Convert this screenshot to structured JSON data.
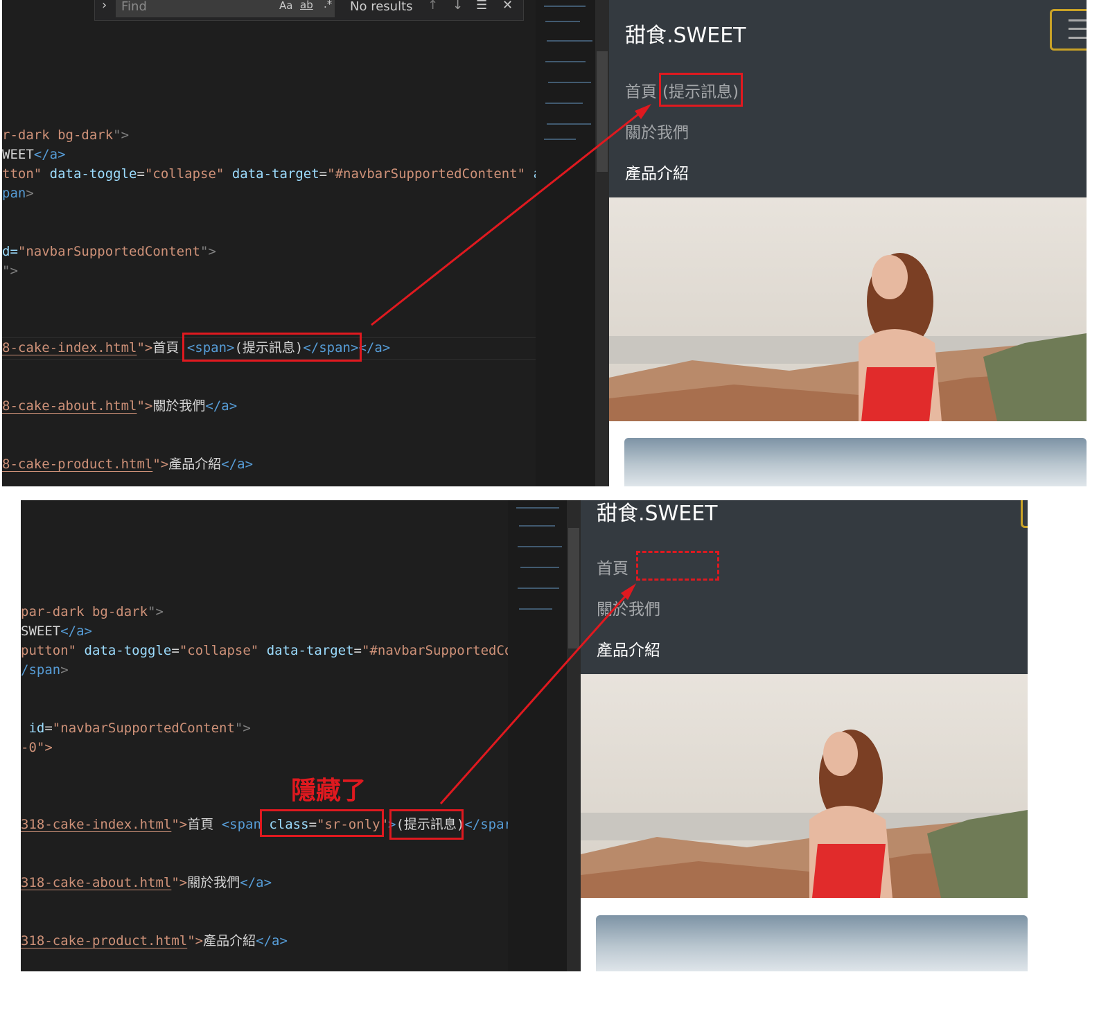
{
  "top": {
    "find_widget": {
      "chevron": "›",
      "placeholder": "Find",
      "opt_case": "Aa",
      "opt_word": "ab",
      "opt_regex": ".*",
      "result": "No results",
      "prev": "↑",
      "next": "↓",
      "sel": "☰",
      "close": "✕"
    },
    "code": {
      "l1": {
        "a": "r-dark bg-dark",
        "q": "\"",
        "end": "\">"
      },
      "l2": {
        "txt": "WEET",
        "close": "</a>"
      },
      "l3": {
        "a": "tton",
        "attr1": "data-toggle",
        "v1": "collapse",
        "attr2": "data-target",
        "v2": "#navbarSupportedContent",
        "tail": "a"
      },
      "l4": {
        "a": "pan",
        "end": ">"
      },
      "l5": {
        "a": "d=",
        "v": "navbarSupportedContent",
        "end": "\">"
      },
      "l6": {
        "a": "\">"
      },
      "l7": {
        "file": "8-cake-index.html",
        "q": "\">",
        "txt": "首頁",
        "span_open": "<span>",
        "span_txt": "(提示訊息)",
        "span_close": "</span>",
        "a_close": "</a>"
      },
      "l8": {
        "file": "8-cake-about.html",
        "q": "\">",
        "txt": "關於我們",
        "a_close": "</a>"
      },
      "l9": {
        "file": "8-cake-product.html",
        "q": "\">",
        "txt": "產品介紹",
        "a_close": "</a>"
      }
    },
    "preview": {
      "brand": "甜食.SWEET",
      "nav_home": "首頁",
      "nav_hint": "(提示訊息)",
      "nav_about": "關於我們",
      "nav_product": "產品介紹"
    }
  },
  "bottom": {
    "code": {
      "l1": {
        "a": "par-dark bg-dark",
        "end": "\">"
      },
      "l2": {
        "txt": "SWEET",
        "close": "</a>"
      },
      "l3": {
        "a": "putton",
        "attr1": "data-toggle",
        "v1": "collapse",
        "attr2": "data-target",
        "v2": "#navbarSupportedCor"
      },
      "l4": {
        "a": "/span",
        "end": ">"
      },
      "l5": {
        "attr": "id",
        "v": "navbarSupportedContent",
        "end": "\">"
      },
      "l6": {
        "a": "-0\">"
      },
      "l7": {
        "file": "318-cake-index.html",
        "q": "\">",
        "txt": "首頁",
        "span_open": "<span",
        "class_attr": "class",
        "class_val": "sr-only",
        "gt": ">",
        "span_txt": "(提示訊息)",
        "span_close": "</spar"
      },
      "l8": {
        "file": "318-cake-about.html",
        "q": "\">",
        "txt": "關於我們",
        "a_close": "</a>"
      },
      "l9": {
        "file": "318-cake-product.html",
        "q": "\">",
        "txt": "產品介紹",
        "a_close": "</a>"
      }
    },
    "annotation": "隱藏了",
    "preview": {
      "brand": "甜食.SWEET",
      "nav_home": "首頁",
      "nav_about": "關於我們",
      "nav_product": "產品介紹"
    }
  },
  "colors": {
    "editor_bg": "#1e1e1e",
    "string": "#ce9178",
    "attr": "#9cdcfe",
    "tag": "#569cd6",
    "navbar": "#343a40",
    "annotation_red": "#e0191f"
  }
}
